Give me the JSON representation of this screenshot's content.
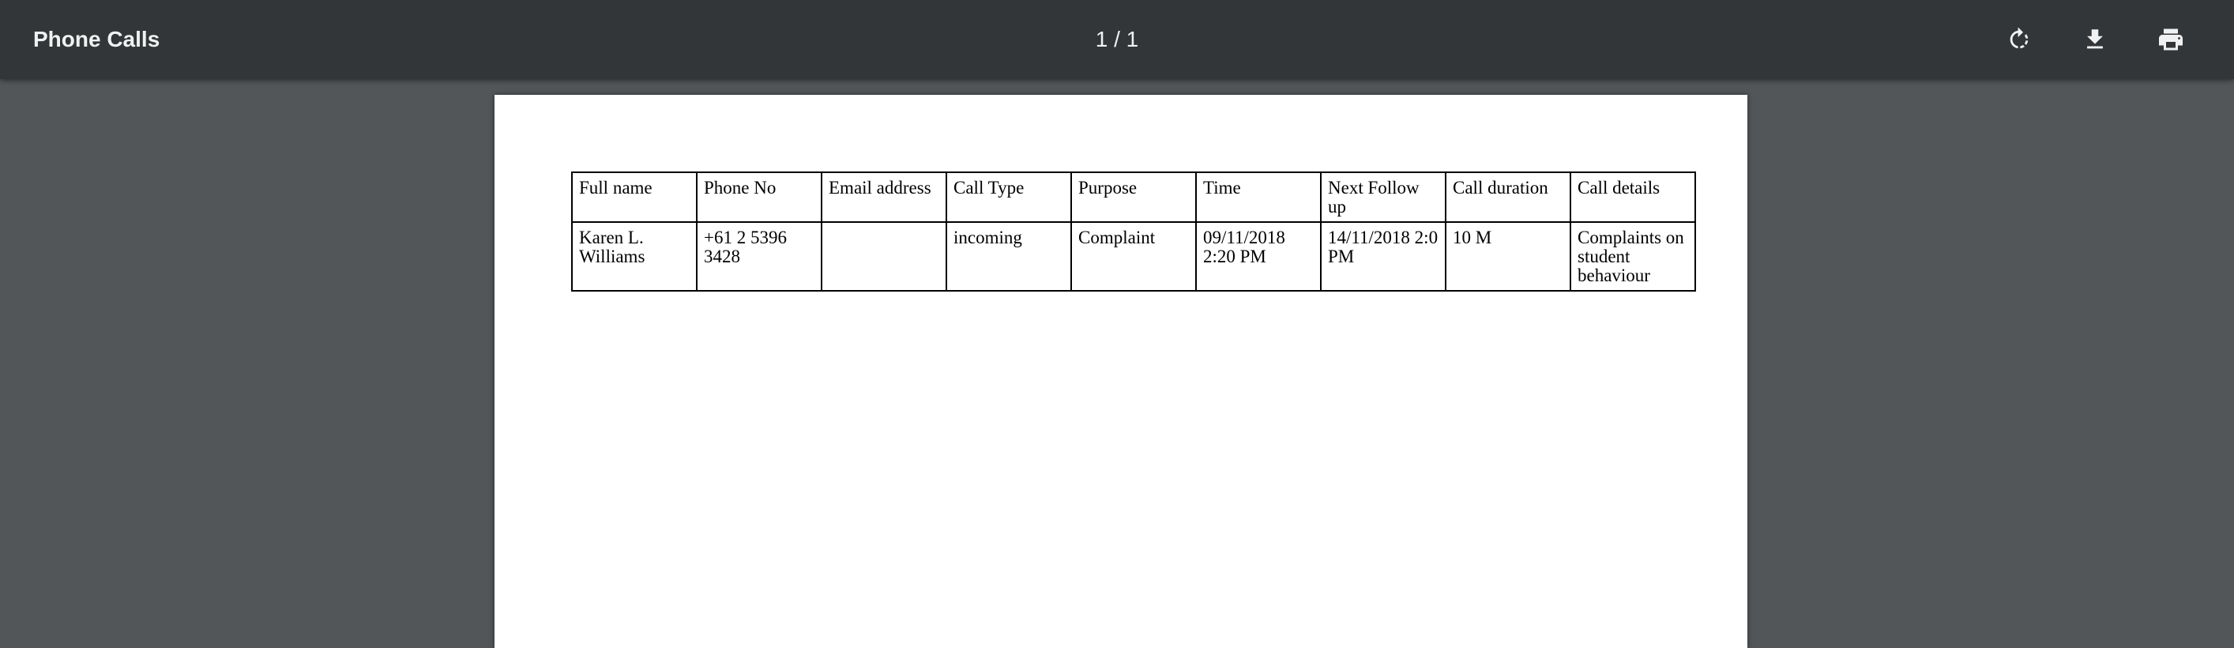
{
  "toolbar": {
    "title": "Phone Calls",
    "page_indicator": "1 / 1",
    "actions": [
      {
        "name": "rotate",
        "icon": "rotate-icon"
      },
      {
        "name": "download",
        "icon": "download-icon"
      },
      {
        "name": "print",
        "icon": "print-icon"
      }
    ]
  },
  "table": {
    "headers": [
      "Full name",
      "Phone No",
      "Email address",
      "Call Type",
      "Purpose",
      "Time",
      "Next Follow up",
      "Call duration",
      "Call details"
    ],
    "rows": [
      [
        "Karen L. Williams",
        "+61 2 5396 3428",
        "",
        "incoming",
        "Complaint",
        "09/11/2018 2:20 PM",
        "14/11/2018 2:0 PM",
        "10 M",
        "Complaints on student behaviour"
      ]
    ]
  },
  "colors": {
    "toolbar_bg": "#323639",
    "viewer_bg": "#525659",
    "page_bg": "#ffffff",
    "toolbar_text": "#f1f1f1"
  }
}
